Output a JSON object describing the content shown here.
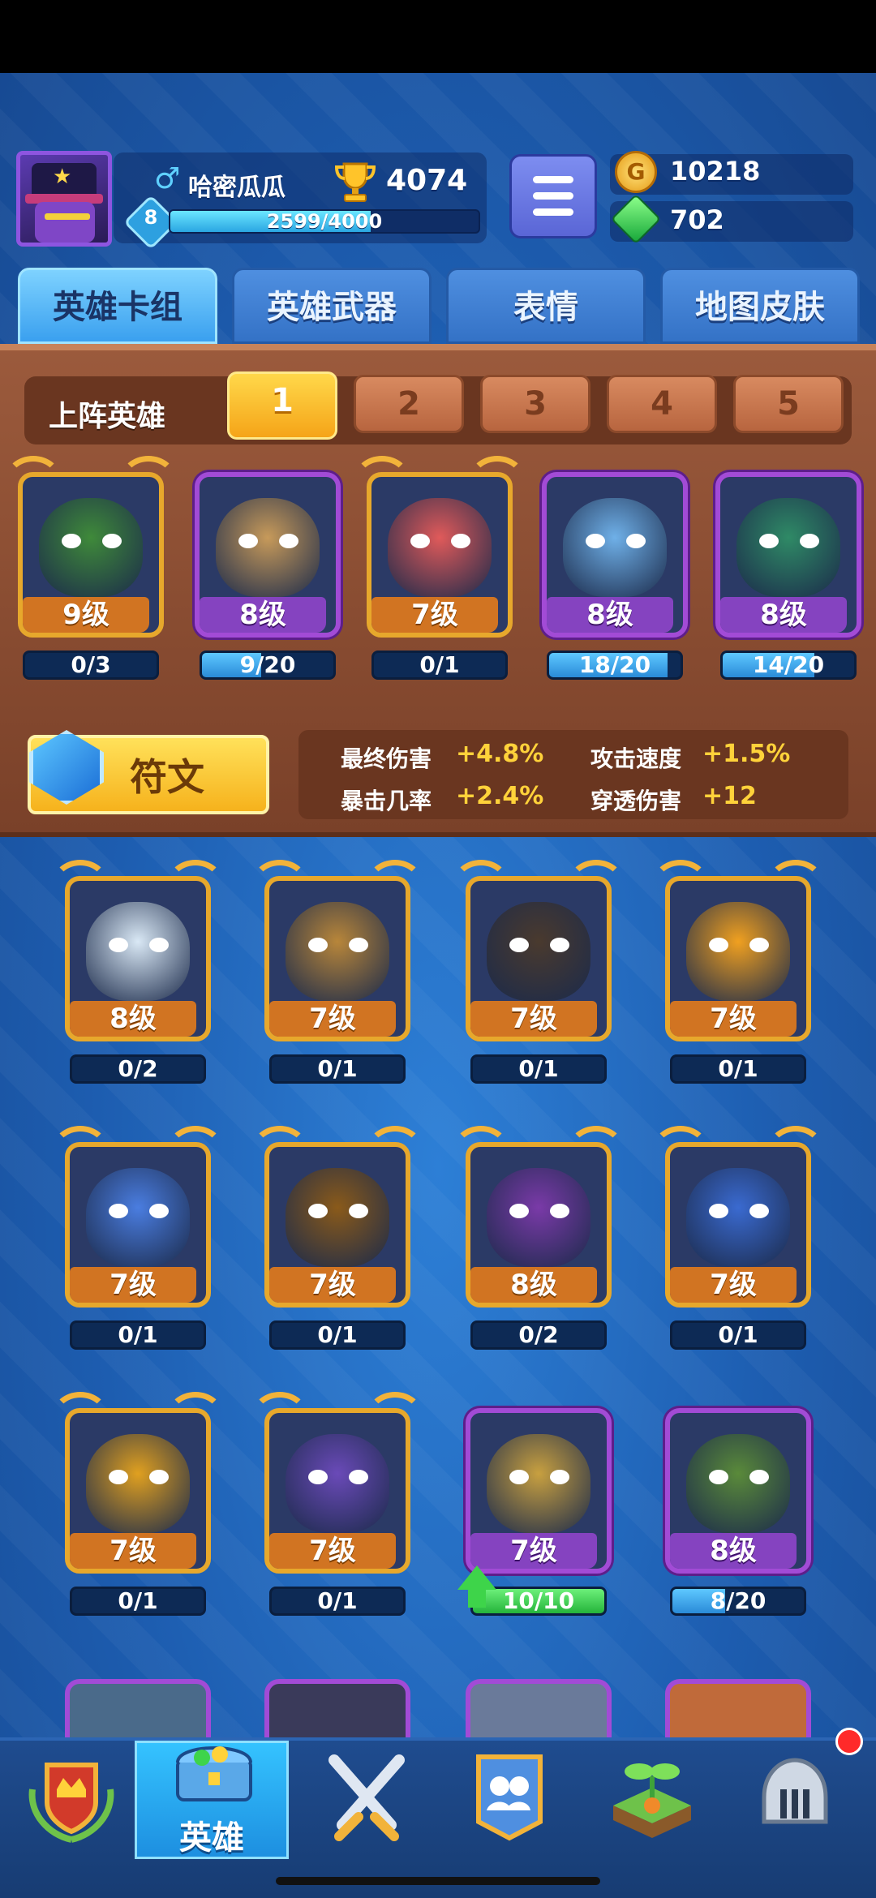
{
  "player": {
    "name": "哈密瓜瓜",
    "gender_symbol": "♂",
    "level": "8",
    "trophies": "4074",
    "xp_text": "2599/4000",
    "xp_fraction": 0.65
  },
  "resources": {
    "gold": "10218",
    "gems": "702"
  },
  "tabs": [
    "英雄卡组",
    "英雄武器",
    "表情",
    "地图皮肤"
  ],
  "lineup": {
    "label": "上阵英雄",
    "decks": [
      "1",
      "2",
      "3",
      "4",
      "5"
    ],
    "heroes": [
      {
        "level": "9级",
        "progress": "0/3",
        "fill": 0.0,
        "rarity": "legendary",
        "color": "#3f8a3a"
      },
      {
        "level": "8级",
        "progress": "9/20",
        "fill": 0.45,
        "rarity": "epic",
        "color": "#c79a5a"
      },
      {
        "level": "7级",
        "progress": "0/1",
        "fill": 0.0,
        "rarity": "legendary",
        "color": "#e05a5a"
      },
      {
        "level": "8级",
        "progress": "18/20",
        "fill": 0.9,
        "rarity": "epic",
        "color": "#6fb0e8"
      },
      {
        "level": "8级",
        "progress": "14/20",
        "fill": 0.7,
        "rarity": "epic",
        "color": "#2f8a66"
      }
    ]
  },
  "rune": {
    "label": "符文",
    "stats": [
      {
        "name": "最终伤害",
        "value": "+4.8%"
      },
      {
        "name": "攻击速度",
        "value": "+1.5%"
      },
      {
        "name": "暴击几率",
        "value": "+2.4%"
      },
      {
        "name": "穿透伤害",
        "value": "+12"
      }
    ]
  },
  "collection": [
    {
      "level": "8级",
      "progress": "0/2",
      "fill": 0.0,
      "rarity": "legendary",
      "color": "#d9e8f5"
    },
    {
      "level": "7级",
      "progress": "0/1",
      "fill": 0.0,
      "rarity": "legendary",
      "color": "#b8863a"
    },
    {
      "level": "7级",
      "progress": "0/1",
      "fill": 0.0,
      "rarity": "legendary",
      "color": "#4a3a2e"
    },
    {
      "level": "7级",
      "progress": "0/1",
      "fill": 0.0,
      "rarity": "legendary",
      "color": "#f0a020"
    },
    {
      "level": "7级",
      "progress": "0/1",
      "fill": 0.0,
      "rarity": "legendary",
      "color": "#4a7de0"
    },
    {
      "level": "7级",
      "progress": "0/1",
      "fill": 0.0,
      "rarity": "legendary",
      "color": "#8a5a1a"
    },
    {
      "level": "8级",
      "progress": "0/2",
      "fill": 0.0,
      "rarity": "legendary",
      "color": "#7a3aa8"
    },
    {
      "level": "7级",
      "progress": "0/1",
      "fill": 0.0,
      "rarity": "legendary",
      "color": "#3a6ad0"
    },
    {
      "level": "7级",
      "progress": "0/1",
      "fill": 0.0,
      "rarity": "legendary",
      "color": "#e0a020"
    },
    {
      "level": "7级",
      "progress": "0/1",
      "fill": 0.0,
      "rarity": "legendary",
      "color": "#6a4ab8"
    },
    {
      "level": "7级",
      "progress": "10/10",
      "fill": 1.0,
      "rarity": "epic",
      "color": "#c8a040",
      "upgrade": true
    },
    {
      "level": "8级",
      "progress": "8/20",
      "fill": 0.4,
      "rarity": "epic",
      "color": "#5a8a3a"
    }
  ],
  "nav": {
    "items": [
      "battle-pass",
      "heroes",
      "battle",
      "clan",
      "garden",
      "knight"
    ],
    "active_label": "英雄"
  },
  "colors": {
    "gold_frame": "#e7a82c",
    "epic_frame": "#a24bd6",
    "background": "#1f5fb3",
    "panel_wood": "#9b5a3c"
  }
}
